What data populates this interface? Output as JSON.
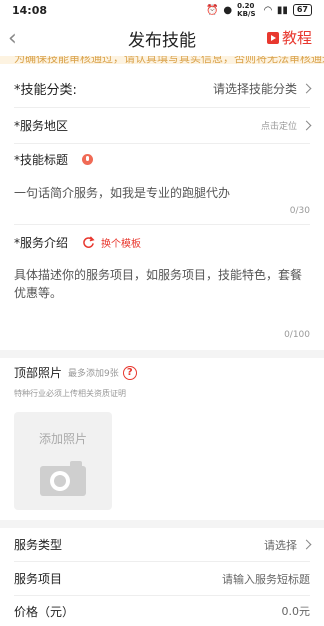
{
  "status_bar": {
    "time": "14:08",
    "network": "0.20 KB/S",
    "battery": "67"
  },
  "nav": {
    "title": "发布技能",
    "tutorial": "教程"
  },
  "notice": {
    "text": "为确保技能审核通过，请认真填写真实信息，否则将无法审核通过"
  },
  "form": {
    "category": {
      "label": "*技能分类:",
      "value": "请选择技能分类"
    },
    "region": {
      "label": "*服务地区",
      "value": "点击定位"
    },
    "skill_title": {
      "label": "*技能标题",
      "placeholder": "一句话简介服务，如我是专业的跑腿代办",
      "counter": "0/30"
    },
    "service_intro": {
      "label": "*服务介绍",
      "change_template": "换个模板",
      "placeholder": "具体描述你的服务项目，如服务项目，技能特色，套餐优惠等。",
      "counter": "0/100"
    }
  },
  "photos": {
    "title": "顶部照片",
    "hint": "最多添加9张",
    "help_icon": "?",
    "subtitle": "特种行业必须上传相关资质证明",
    "add_label": "添加照片"
  },
  "service": {
    "type": {
      "label": "服务类型",
      "value": "请选择"
    },
    "item": {
      "label": "服务项目",
      "value": "请输入服务短标题"
    },
    "price": {
      "label": "价格（元）",
      "value": "0.0元"
    }
  },
  "colors": {
    "accent": "#e8382f",
    "notice_bg": "#fdf3e1",
    "divider_bg": "#f4f4f4"
  }
}
